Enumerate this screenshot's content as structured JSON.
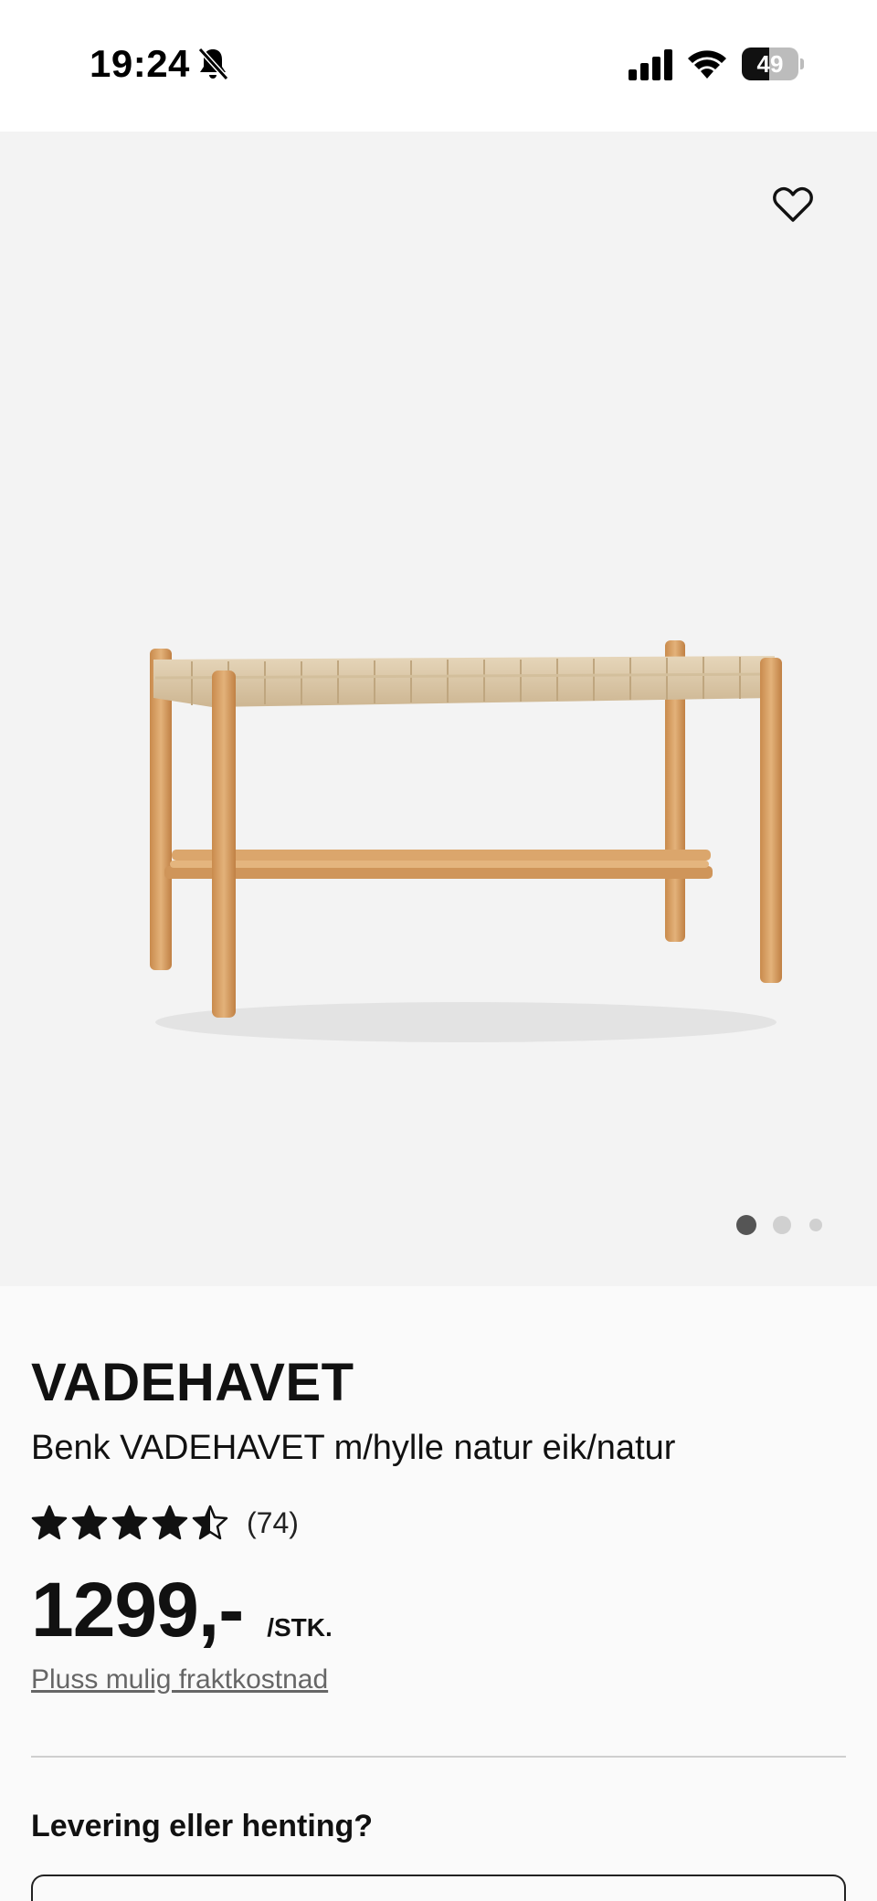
{
  "status_bar": {
    "time": "19:24",
    "battery_percent": "49",
    "battery_level": 0.49,
    "icons": [
      "bell-slash-icon",
      "signal-icon",
      "wifi-icon",
      "battery-icon"
    ]
  },
  "gallery": {
    "favorite_icon": "heart-outline-icon",
    "dot_count": 3,
    "active_index": 0
  },
  "product": {
    "brand": "VADEHAVET",
    "subtitle": "Benk VADEHAVET m/hylle natur eik/natur",
    "rating": 4.5,
    "rating_count": "(74)",
    "price": "1299,-",
    "price_unit": "/STK.",
    "shipping_link": "Pluss mulig fraktkostnad"
  },
  "delivery": {
    "heading": "Levering eller henting?"
  },
  "colors": {
    "status_bg": "#ffffff",
    "image_bg": "#f3f3f3",
    "page_bg": "#fafafa",
    "text": "#111111",
    "muted": "#666666",
    "dot_active": "#555555",
    "dot_inactive": "#d0d0d0",
    "wood": "#d9a468",
    "seat": "#d8c4a2"
  }
}
